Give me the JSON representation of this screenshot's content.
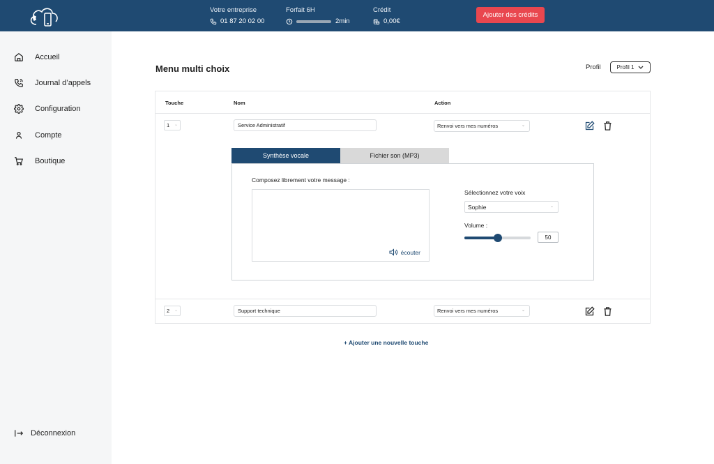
{
  "header": {
    "company_label": "Votre entreprise",
    "company_phone": "01 87 20 02 00",
    "plan_label": "Forfait 6H",
    "plan_remaining": "2min",
    "plan_usage_fraction": 0.95,
    "credit_label": "Crédit",
    "credit_value": "0,00€",
    "add_credits_label": "Ajouter des crédits",
    "colors": {
      "bar": "#1f4a72",
      "cta": "#e9474f"
    }
  },
  "sidebar": {
    "items": [
      {
        "label": "Accueil",
        "icon": "home-icon"
      },
      {
        "label": "Journal d’appels",
        "icon": "phone-log-icon"
      },
      {
        "label": "Configuration",
        "icon": "gear-icon"
      },
      {
        "label": "Compte",
        "icon": "user-icon"
      },
      {
        "label": "Boutique",
        "icon": "cart-icon"
      }
    ],
    "logout_label": "Déconnexion"
  },
  "main": {
    "title": "Menu multi choix",
    "profile_label": "Profil",
    "profile_value": "Profil 1",
    "columns": [
      "Touche",
      "Nom",
      "Action"
    ],
    "rows": [
      {
        "key": "1",
        "name": "Service Administratif",
        "action": "Renvoi vers mes numéros"
      },
      {
        "key": "2",
        "name": "Support technique",
        "action": "Renvoi vers mes numéros"
      }
    ],
    "tabs": [
      "Synthèse vocale",
      "Fichier son (MP3)"
    ],
    "active_tab": 0,
    "message_label": "Composez librement votre message :",
    "message_value": "",
    "listen_label": "écouter",
    "voice_label": "Sélectionnez votre voix",
    "voice_value": "Sophie",
    "volume_label": "Volume :",
    "volume_value": "50",
    "add_key_label": "+ Ajouter une nouvelle touche"
  }
}
